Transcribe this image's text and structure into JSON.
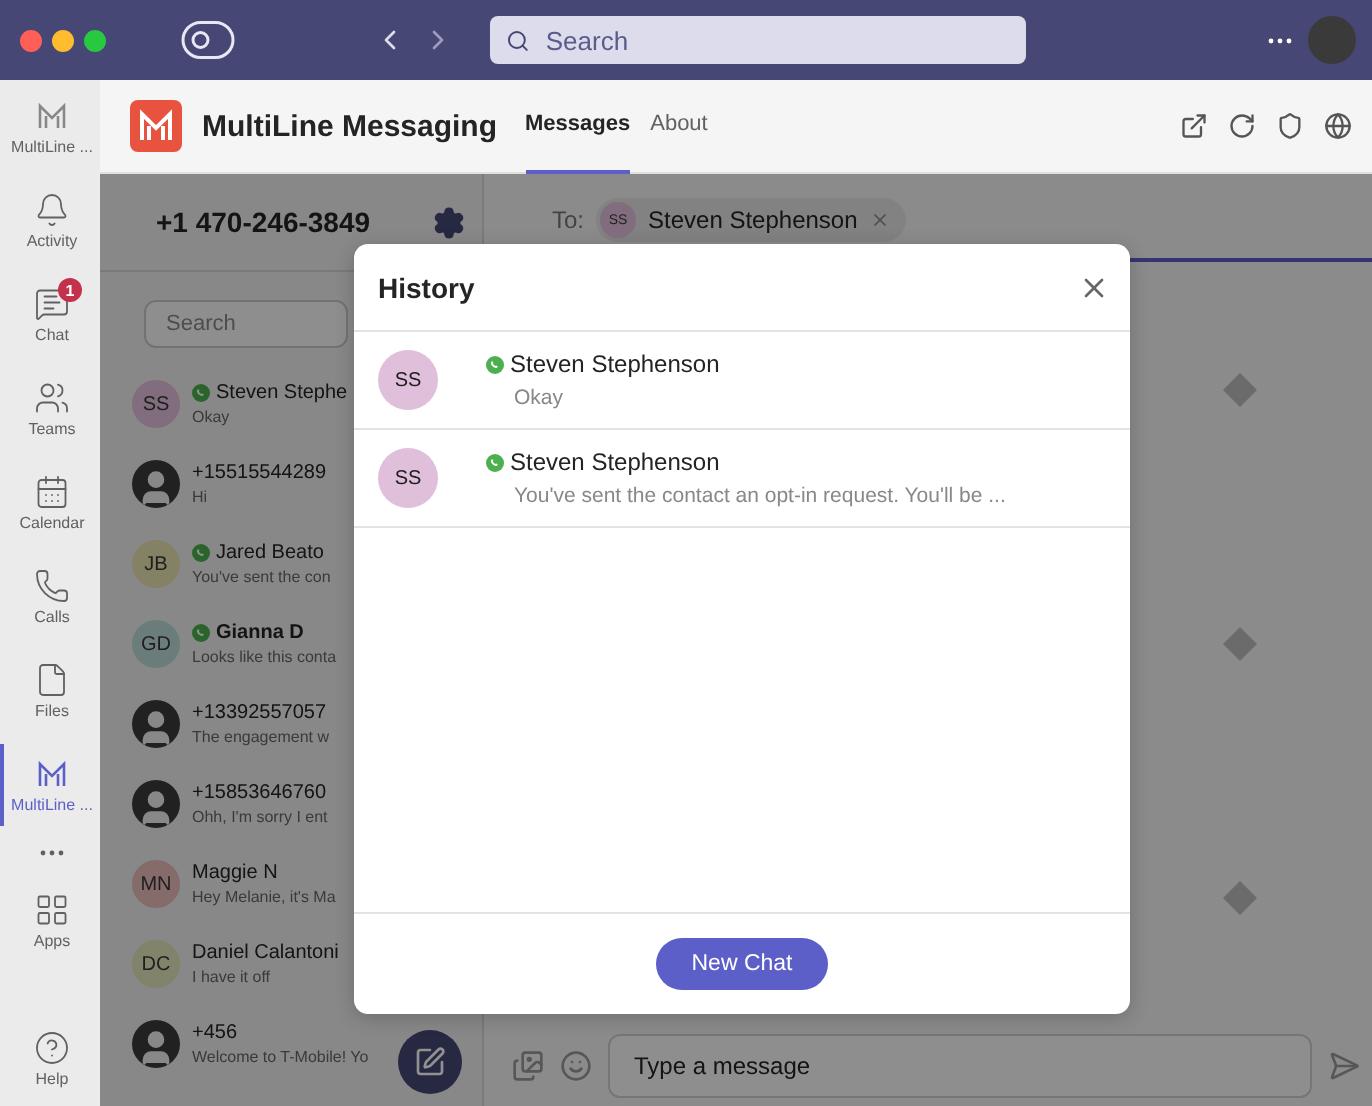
{
  "title_bar": {
    "search": {
      "placeholder": "Search"
    }
  },
  "rail": {
    "items": [
      {
        "kind": "app",
        "label": "Activity",
        "selected": false
      },
      {
        "kind": "app",
        "label": "Chat",
        "selected": false,
        "badge": "1"
      },
      {
        "kind": "app",
        "label": "Teams",
        "selected": false
      },
      {
        "kind": "app",
        "label": "Calendar",
        "selected": false
      },
      {
        "kind": "app",
        "label": "Calls",
        "selected": false
      },
      {
        "kind": "app",
        "label": "Files",
        "selected": false
      },
      {
        "kind": "app",
        "label": "MultiLine ...",
        "selected": true
      },
      {
        "kind": "more",
        "selected": false
      },
      {
        "kind": "app",
        "label": "Apps",
        "selected": false
      }
    ],
    "top_item": {
      "label": "MultiLine ..."
    },
    "help": {
      "label": "Help"
    }
  },
  "app_header": {
    "title": "MultiLine Messaging",
    "tabs": [
      {
        "label": "Messages",
        "selected": true
      },
      {
        "label": "About",
        "selected": false
      }
    ]
  },
  "line_panel": {
    "phone": "+1 470-246-3849",
    "search": {
      "placeholder": "Search"
    },
    "conversations": [
      {
        "avatar": {
          "kind": "initials",
          "text": "SS",
          "color": "#816d7d"
        },
        "badge": true,
        "name": "Steven Stephe",
        "preview": "Okay",
        "unread": false
      },
      {
        "avatar": {
          "kind": "person"
        },
        "badge": false,
        "name": "+15515544289",
        "preview": "Hi",
        "unread": false
      },
      {
        "avatar": {
          "kind": "initials",
          "text": "JB",
          "color": "#848165"
        },
        "badge": true,
        "name": "Jared Beato",
        "preview": "You've sent the con",
        "unread": false
      },
      {
        "avatar": {
          "kind": "initials",
          "text": "GD",
          "color": "#6b7d7b"
        },
        "badge": true,
        "name": "Gianna D",
        "preview": "Looks like this conta",
        "unread": true
      },
      {
        "avatar": {
          "kind": "person"
        },
        "badge": false,
        "name": "+13392557057",
        "preview": "The engagement w",
        "unread": false
      },
      {
        "avatar": {
          "kind": "person"
        },
        "badge": false,
        "name": "+15853646760",
        "preview": "Ohh, I'm sorry I ent",
        "unread": false
      },
      {
        "avatar": {
          "kind": "initials",
          "text": "MN",
          "color": "#866b6b"
        },
        "badge": false,
        "name": "Maggie N",
        "preview": "Hey Melanie, it's Ma",
        "unread": false
      },
      {
        "avatar": {
          "kind": "initials",
          "text": "DC",
          "color": "#82836b"
        },
        "badge": false,
        "name": "Daniel Calantoni",
        "preview": "I have it off",
        "unread": false
      },
      {
        "avatar": {
          "kind": "person"
        },
        "badge": false,
        "name": "+456",
        "preview": "Welcome to T-Mobile! Yo",
        "unread": false
      }
    ]
  },
  "chat": {
    "to_label": "To:",
    "recipient": {
      "initials": "SS",
      "color": "#816d7d",
      "name": "Steven Stephenson"
    },
    "composer": {
      "placeholder": "Type a message"
    }
  },
  "dialog": {
    "title": "History",
    "entries": [
      {
        "avatar": {
          "initials": "SS",
          "color": "#dfbfd9"
        },
        "badge": true,
        "name": "Steven Stephenson",
        "preview": "Okay"
      },
      {
        "avatar": {
          "initials": "SS",
          "color": "#dfbfd9"
        },
        "badge": true,
        "name": "Steven Stephenson",
        "preview": "You've sent the contact an opt-in request. You'll be ..."
      }
    ],
    "button": "New Chat"
  }
}
